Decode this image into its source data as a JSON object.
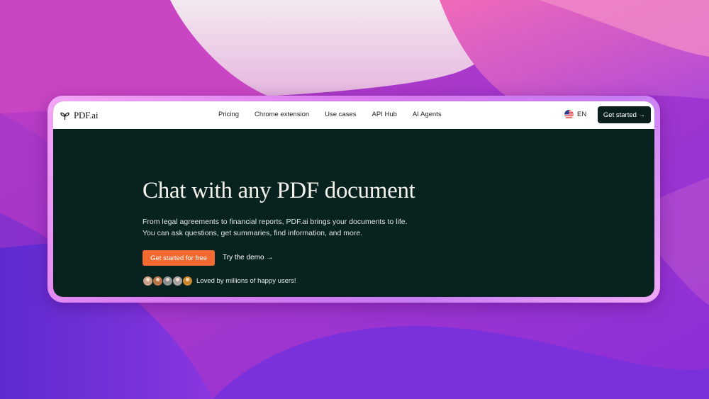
{
  "nav": {
    "logo_text": "PDF.ai",
    "links": [
      "Pricing",
      "Chrome extension",
      "Use cases",
      "API Hub",
      "AI Agents"
    ],
    "language": "EN",
    "cta_label": "Get started →"
  },
  "hero": {
    "title": "Chat with any PDF document",
    "subtitle_line1": "From legal agreements to financial reports, PDF.ai brings your documents to life.",
    "subtitle_line2": "You can ask questions, get summaries, find information, and more.",
    "primary_cta": "Get started for free",
    "secondary_cta": "Try the demo →",
    "social_proof": "Loved by millions of happy users!"
  },
  "colors": {
    "hero_bg": "#08221f",
    "primary_cta": "#f26a30",
    "nav_cta": "#0a1f1c"
  },
  "icons": {
    "logo": "sprout-icon",
    "language": "us-flag-icon"
  }
}
